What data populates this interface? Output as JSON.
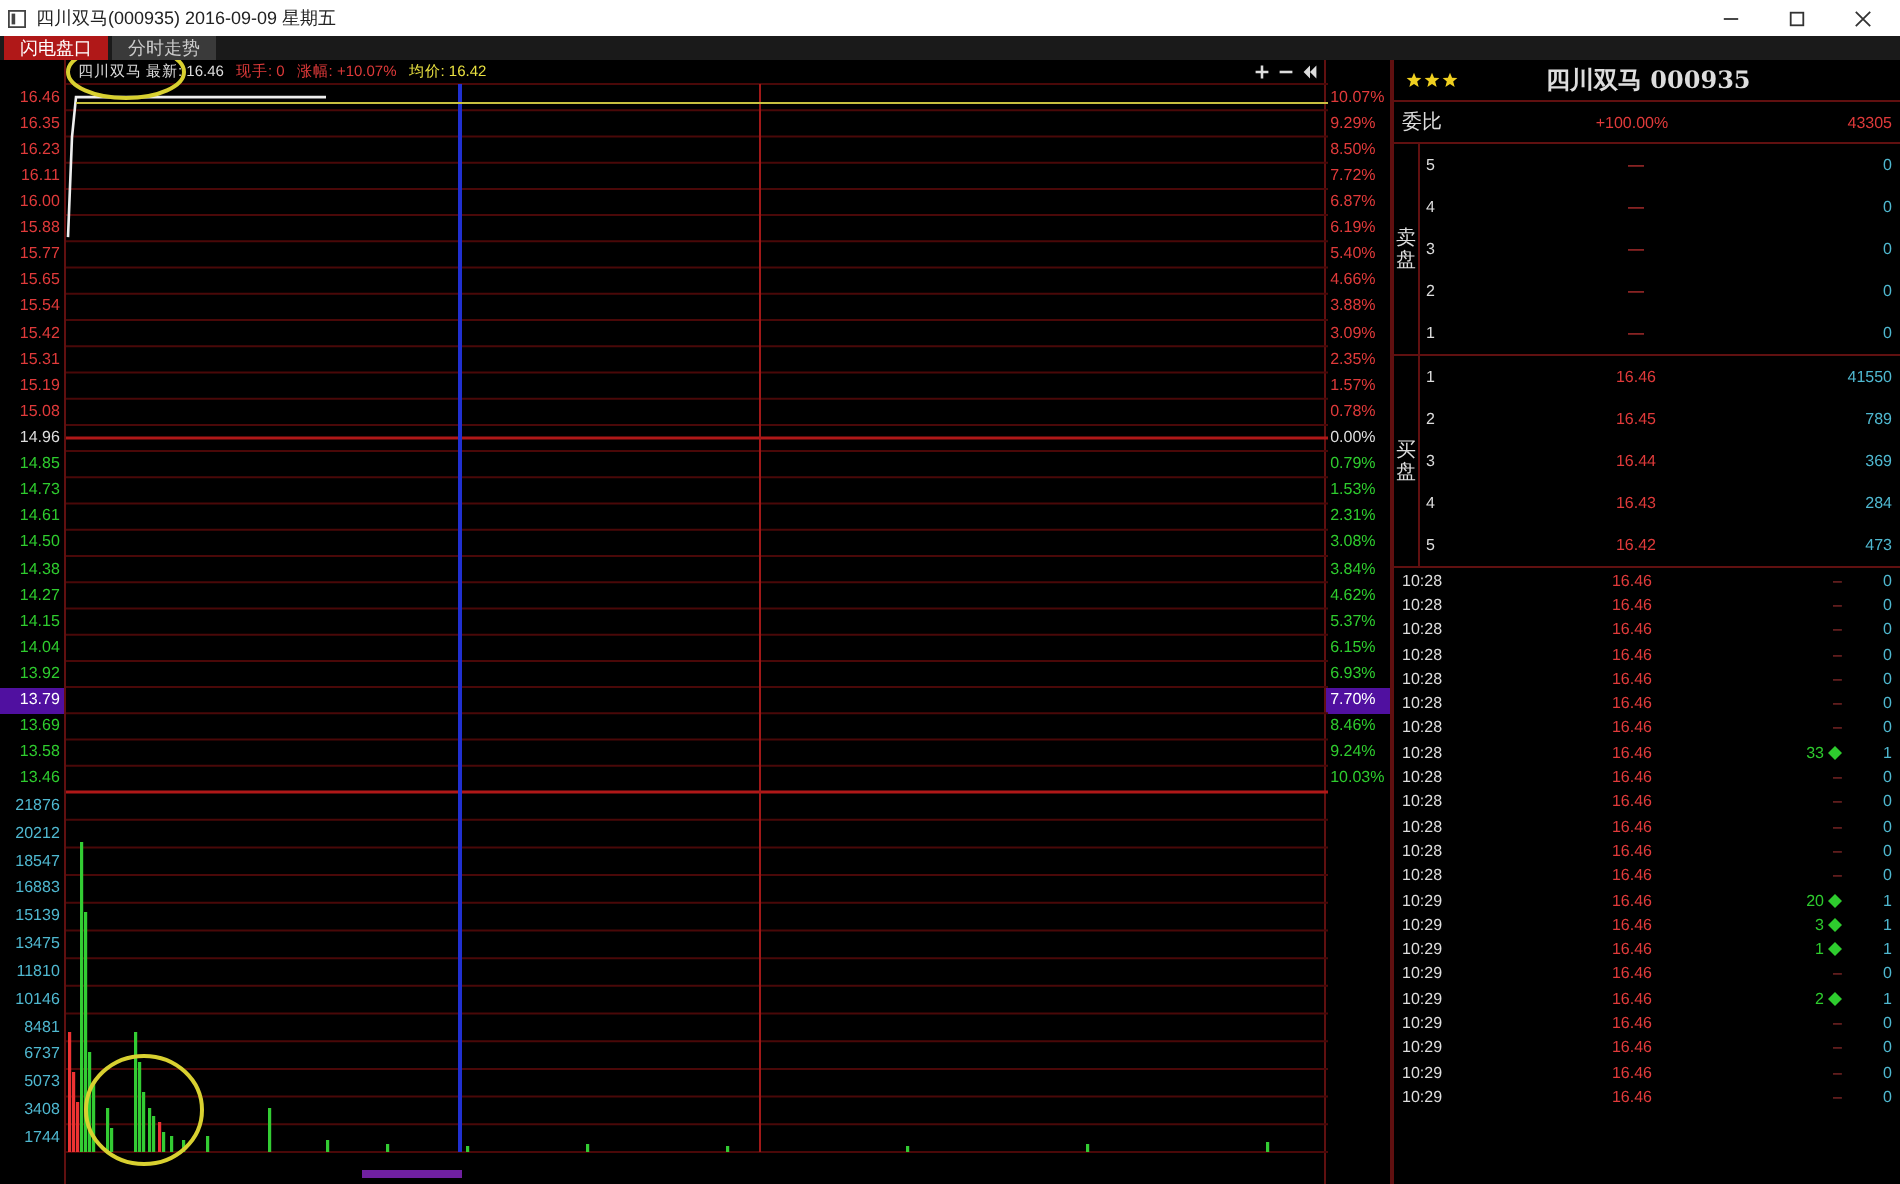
{
  "window": {
    "title": "四川双马(000935) 2016-09-09 星期五"
  },
  "tabs": [
    {
      "label": "闪电盘口",
      "selected": true
    },
    {
      "label": "分时走势",
      "selected": false
    }
  ],
  "chart": {
    "info": [
      {
        "text": "四川双马 最新: 16.46",
        "kind": "plain"
      },
      {
        "text": "现手: 0",
        "kind": "up"
      },
      {
        "text": "涨幅: +10.07%",
        "kind": "up"
      },
      {
        "text": "均价: 16.42",
        "kind": "avg"
      }
    ],
    "price_levels": [
      {
        "price": "16.46",
        "pct": "10.07%",
        "kind": "up",
        "selected": false
      },
      {
        "price": "16.35",
        "pct": "9.29%",
        "kind": "up",
        "selected": false
      },
      {
        "price": "16.23",
        "pct": "8.50%",
        "kind": "up",
        "selected": false
      },
      {
        "price": "16.11",
        "pct": "7.72%",
        "kind": "up",
        "selected": false
      },
      {
        "price": "16.00",
        "pct": "6.87%",
        "kind": "up",
        "selected": false
      },
      {
        "price": "15.88",
        "pct": "6.19%",
        "kind": "up",
        "selected": false
      },
      {
        "price": "15.77",
        "pct": "5.40%",
        "kind": "up",
        "selected": false
      },
      {
        "price": "15.65",
        "pct": "4.66%",
        "kind": "up",
        "selected": false
      },
      {
        "price": "15.54",
        "pct": "3.88%",
        "kind": "up",
        "selected": false
      },
      {
        "price": "15.42",
        "pct": "3.09%",
        "kind": "up",
        "selected": false
      },
      {
        "price": "15.31",
        "pct": "2.35%",
        "kind": "up",
        "selected": false
      },
      {
        "price": "15.19",
        "pct": "1.57%",
        "kind": "up",
        "selected": false
      },
      {
        "price": "15.08",
        "pct": "0.78%",
        "kind": "up",
        "selected": false
      },
      {
        "price": "14.96",
        "pct": "0.00%",
        "kind": "flat",
        "selected": false
      },
      {
        "price": "14.85",
        "pct": "0.79%",
        "kind": "down",
        "selected": false
      },
      {
        "price": "14.73",
        "pct": "1.53%",
        "kind": "down",
        "selected": false
      },
      {
        "price": "14.61",
        "pct": "2.31%",
        "kind": "down",
        "selected": false
      },
      {
        "price": "14.50",
        "pct": "3.08%",
        "kind": "down",
        "selected": false
      },
      {
        "price": "14.38",
        "pct": "3.84%",
        "kind": "down",
        "selected": false
      },
      {
        "price": "14.27",
        "pct": "4.62%",
        "kind": "down",
        "selected": false
      },
      {
        "price": "14.15",
        "pct": "5.37%",
        "kind": "down",
        "selected": false
      },
      {
        "price": "14.04",
        "pct": "6.15%",
        "kind": "down",
        "selected": false
      },
      {
        "price": "13.92",
        "pct": "6.93%",
        "kind": "down",
        "selected": false
      },
      {
        "price": "13.79",
        "pct": "7.70%",
        "kind": "down",
        "selected": true
      },
      {
        "price": "13.69",
        "pct": "8.46%",
        "kind": "down",
        "selected": false
      },
      {
        "price": "13.58",
        "pct": "9.24%",
        "kind": "down",
        "selected": false
      },
      {
        "price": "13.46",
        "pct": "10.03%",
        "kind": "down",
        "selected": false
      }
    ],
    "volume_levels": [
      "21876",
      "20212",
      "18547",
      "16883",
      "15139",
      "13475",
      "11810",
      "10146",
      "8481",
      "6737",
      "5073",
      "3408",
      "1744"
    ]
  },
  "quote": {
    "stars": 3,
    "title": "四川双马 000935",
    "order_ratio": {
      "label": "委比",
      "pct": "+100.00%",
      "diff": "43305"
    },
    "asks": {
      "label": "卖盘",
      "levels": [
        {
          "n": "5",
          "price": "—",
          "volume": "0"
        },
        {
          "n": "4",
          "price": "—",
          "volume": "0"
        },
        {
          "n": "3",
          "price": "—",
          "volume": "0"
        },
        {
          "n": "2",
          "price": "—",
          "volume": "0"
        },
        {
          "n": "1",
          "price": "—",
          "volume": "0"
        }
      ]
    },
    "bids": {
      "label": "买盘",
      "levels": [
        {
          "n": "1",
          "price": "16.46",
          "volume": "41550"
        },
        {
          "n": "2",
          "price": "16.45",
          "volume": "789"
        },
        {
          "n": "3",
          "price": "16.44",
          "volume": "369"
        },
        {
          "n": "4",
          "price": "16.43",
          "volume": "284"
        },
        {
          "n": "5",
          "price": "16.42",
          "volume": "473"
        }
      ]
    },
    "trades": [
      {
        "time": "10:28",
        "price": "16.46",
        "volume": "–",
        "kind": "none",
        "count": "0"
      },
      {
        "time": "10:28",
        "price": "16.46",
        "volume": "–",
        "kind": "none",
        "count": "0"
      },
      {
        "time": "10:28",
        "price": "16.46",
        "volume": "–",
        "kind": "none",
        "count": "0"
      },
      {
        "time": "10:28",
        "price": "16.46",
        "volume": "–",
        "kind": "none",
        "count": "0"
      },
      {
        "time": "10:28",
        "price": "16.46",
        "volume": "–",
        "kind": "none",
        "count": "0"
      },
      {
        "time": "10:28",
        "price": "16.46",
        "volume": "–",
        "kind": "none",
        "count": "0"
      },
      {
        "time": "10:28",
        "price": "16.46",
        "volume": "–",
        "kind": "none",
        "count": "0"
      },
      {
        "time": "10:28",
        "price": "16.46",
        "volume": "33",
        "kind": "sell",
        "count": "1"
      },
      {
        "time": "10:28",
        "price": "16.46",
        "volume": "–",
        "kind": "none",
        "count": "0"
      },
      {
        "time": "10:28",
        "price": "16.46",
        "volume": "–",
        "kind": "none",
        "count": "0"
      },
      {
        "time": "10:28",
        "price": "16.46",
        "volume": "–",
        "kind": "none",
        "count": "0"
      },
      {
        "time": "10:28",
        "price": "16.46",
        "volume": "–",
        "kind": "none",
        "count": "0"
      },
      {
        "time": "10:28",
        "price": "16.46",
        "volume": "–",
        "kind": "none",
        "count": "0"
      },
      {
        "time": "10:29",
        "price": "16.46",
        "volume": "20",
        "kind": "sell",
        "count": "1"
      },
      {
        "time": "10:29",
        "price": "16.46",
        "volume": "3",
        "kind": "sell",
        "count": "1"
      },
      {
        "time": "10:29",
        "price": "16.46",
        "volume": "1",
        "kind": "sell",
        "count": "1"
      },
      {
        "time": "10:29",
        "price": "16.46",
        "volume": "–",
        "kind": "none",
        "count": "0"
      },
      {
        "time": "10:29",
        "price": "16.46",
        "volume": "2",
        "kind": "sell",
        "count": "1"
      },
      {
        "time": "10:29",
        "price": "16.46",
        "volume": "–",
        "kind": "none",
        "count": "0"
      },
      {
        "time": "10:29",
        "price": "16.46",
        "volume": "–",
        "kind": "none",
        "count": "0"
      },
      {
        "time": "10:29",
        "price": "16.46",
        "volume": "–",
        "kind": "none",
        "count": "0"
      },
      {
        "time": "10:29",
        "price": "16.46",
        "volume": "–",
        "kind": "none",
        "count": "0"
      }
    ]
  }
}
